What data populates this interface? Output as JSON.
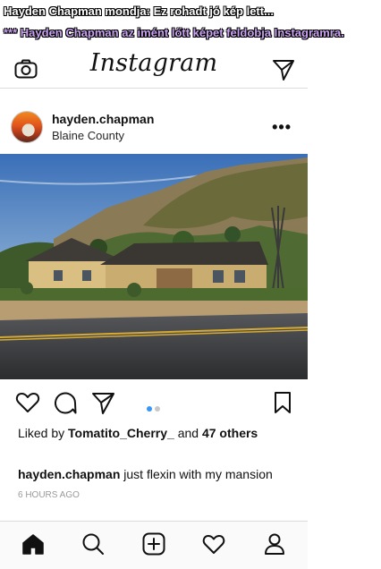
{
  "chat": {
    "line1": "Hayden Chapman mondja: Ez rohadt jó kép lett...",
    "line2": "*** Hayden Chapman az imént lőtt képet feldobja Instagramra."
  },
  "app": {
    "logo": "Instagram",
    "icons": {
      "camera": "camera-icon",
      "direct": "send-icon"
    }
  },
  "post": {
    "username": "hayden.chapman",
    "location": "Blaine County",
    "more": "•••",
    "liked_prefix": "Liked by",
    "liked_user": "Tomatito_Cherry_",
    "liked_and": "and",
    "liked_others": "47 others",
    "caption_user": "hayden.chapman",
    "caption_text": "just flexin with my mansion",
    "time": "6 HOURS AGO",
    "carousel": {
      "total": 2,
      "current": 1
    }
  },
  "colors": {
    "chat_white": "#ffffff",
    "chat_purple": "#c9a2f0",
    "carousel_active": "#3897f0",
    "carousel_inactive": "#c7c7c7"
  }
}
